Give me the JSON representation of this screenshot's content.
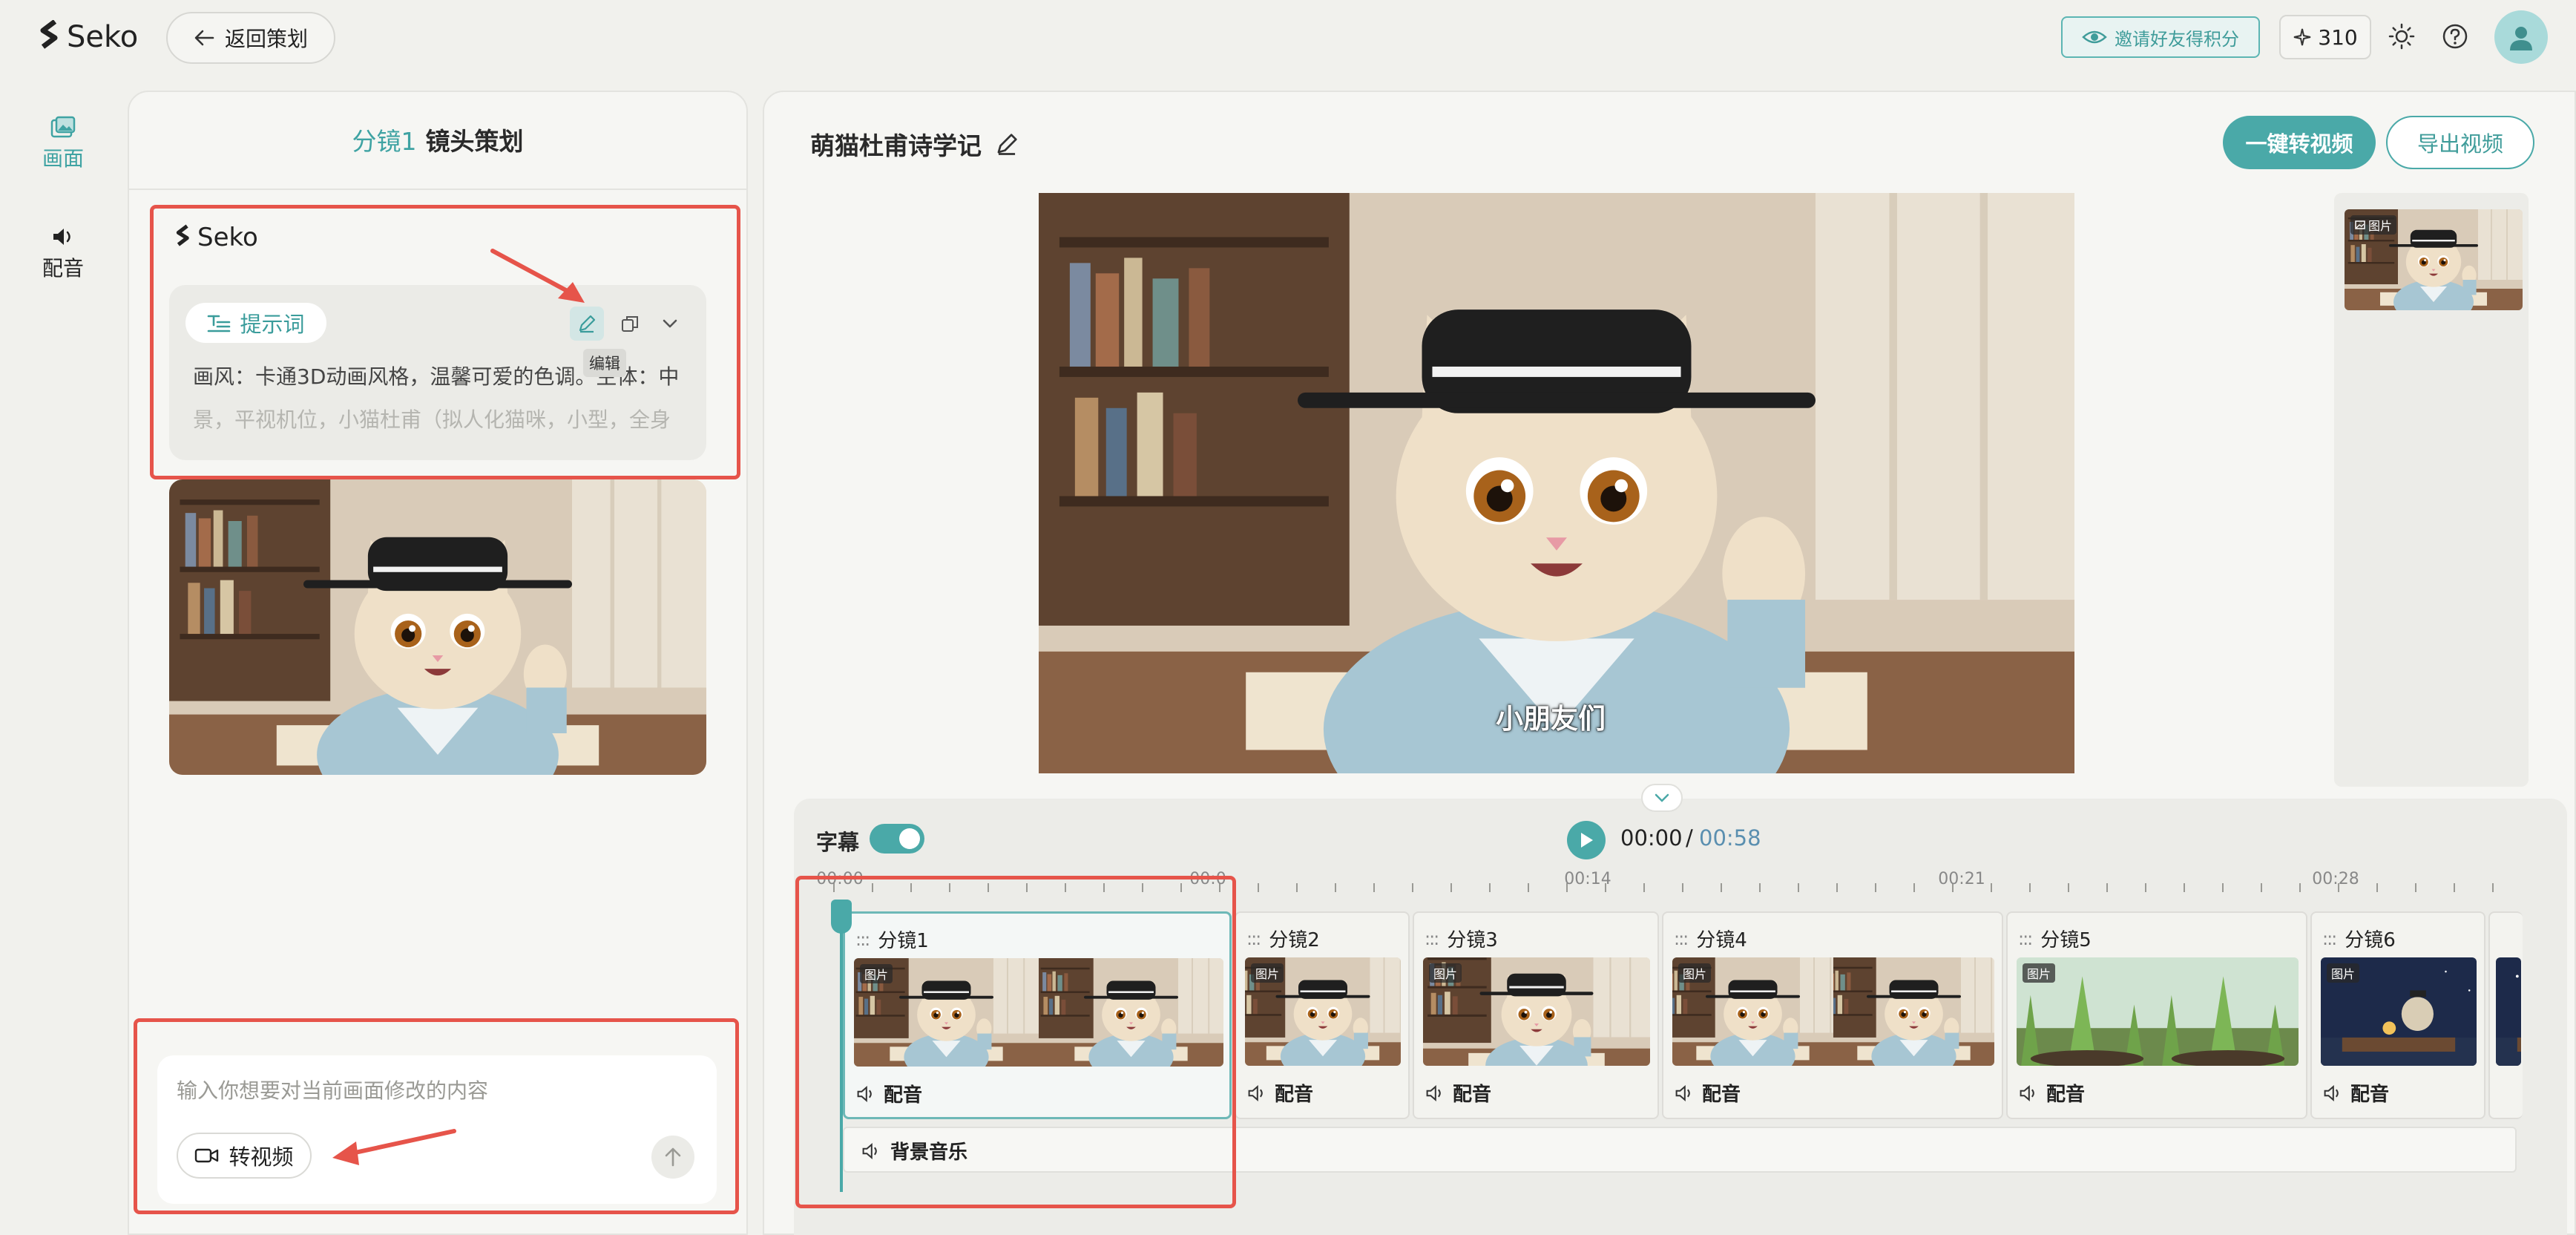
{
  "app": {
    "logo_text": "Seko",
    "brand_color": "#4aa9a8",
    "highlight_color": "#e6544a"
  },
  "topbar": {
    "back_label": "返回策划",
    "invite_label": "邀请好友得积分",
    "credits": "310"
  },
  "rail": {
    "items": [
      {
        "label": "画面",
        "icon": "image-icon",
        "active": true
      },
      {
        "label": "配音",
        "icon": "speaker-icon",
        "active": false
      }
    ]
  },
  "left_panel": {
    "header_accent": "分镜1",
    "header_title": "镜头策划",
    "card_logo": "Seko",
    "prompt_pill": "提示词",
    "tooltip": "编辑",
    "prompt_line1": "画风：卡通3D动画风格，温馨可爱的色调。主体：中",
    "prompt_line2": "景，平视机位，小猫杜甫（拟人化猫咪，小型，全身",
    "input_placeholder": "输入你想要对当前画面修改的内容",
    "to_video_label": "转视频"
  },
  "main": {
    "project_title": "萌猫杜甫诗学记",
    "primary_button": "一键转视频",
    "export_button": "导出视频",
    "subtitle_text": "小朋友们",
    "side_badge": "图片"
  },
  "timeline": {
    "subtitle_toggle_label": "字幕",
    "subtitle_on": true,
    "time_current": "00:00",
    "time_separator": "/",
    "time_total": "00:58",
    "ruler_labels": [
      "00:00",
      "00:0",
      "00:14",
      "00:21",
      "00:28"
    ],
    "shots": [
      {
        "name": "分镜1",
        "badge": "图片",
        "audio": "配音"
      },
      {
        "name": "分镜2",
        "badge": "图片",
        "audio": "配音"
      },
      {
        "name": "分镜3",
        "badge": "图片",
        "audio": "配音"
      },
      {
        "name": "分镜4",
        "badge": "图片",
        "audio": "配音"
      },
      {
        "name": "分镜5",
        "badge": "图片",
        "audio": "配音"
      },
      {
        "name": "分镜6",
        "badge": "图片",
        "audio": "配音"
      }
    ],
    "bgm_label": "背景音乐"
  }
}
